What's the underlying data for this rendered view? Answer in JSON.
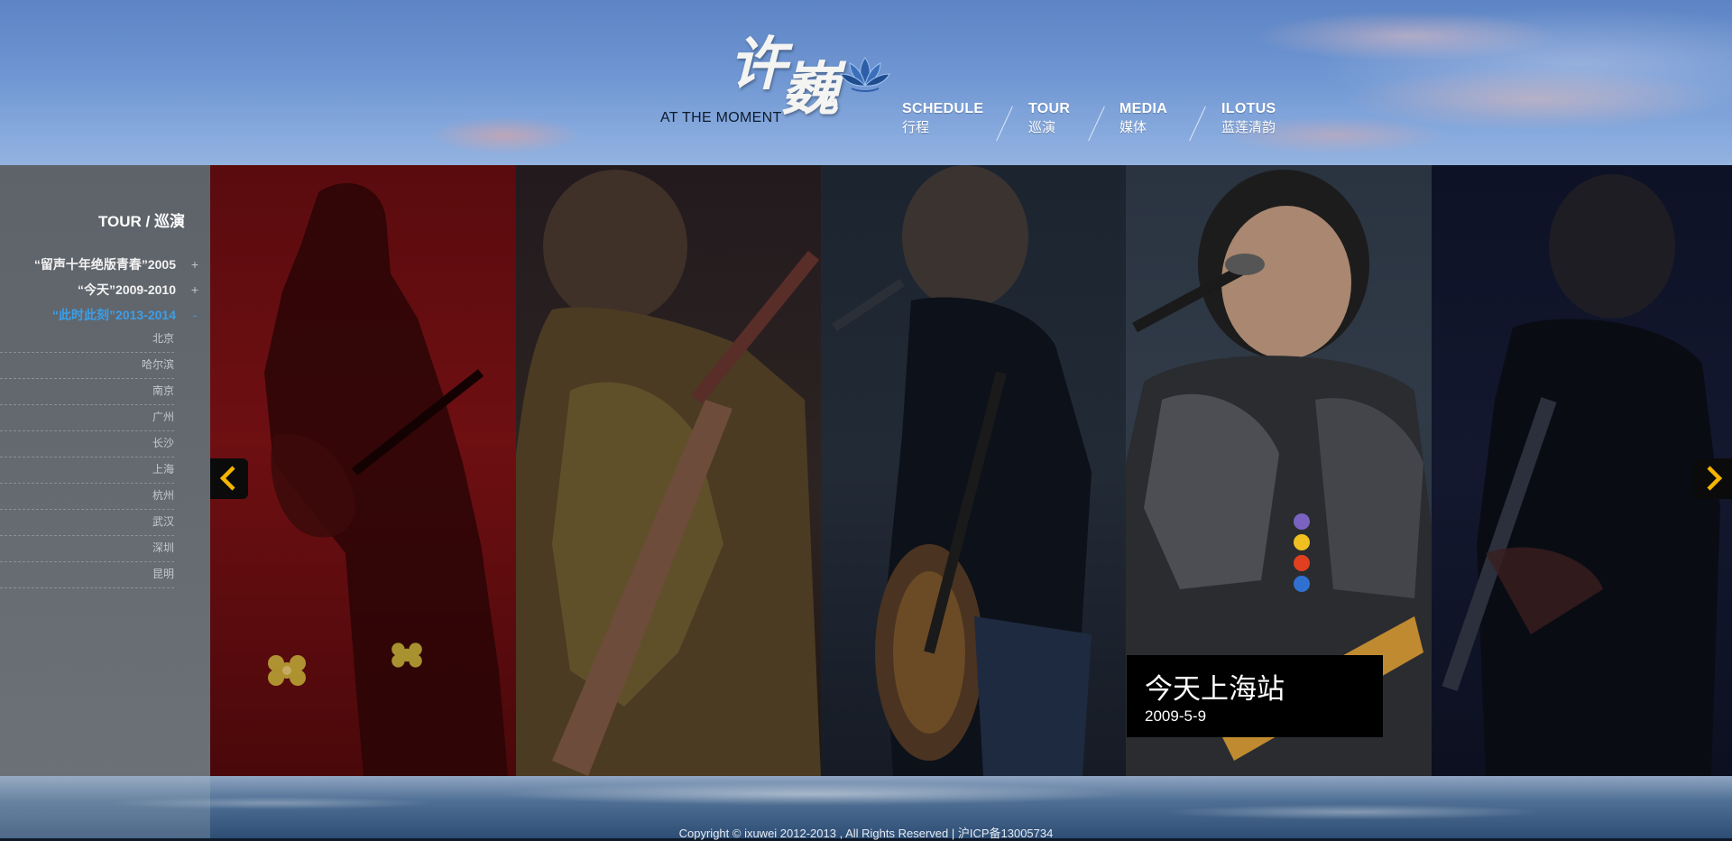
{
  "brand": {
    "logo_subtitle": "AT THE MOMENT",
    "logo_glyph_1": "许",
    "logo_glyph_2": "巍"
  },
  "nav": [
    {
      "en": "SCHEDULE",
      "cn": "行程"
    },
    {
      "en": "TOUR",
      "cn": "巡演"
    },
    {
      "en": "MEDIA",
      "cn": "媒体"
    },
    {
      "en": "ILOTUS",
      "cn": "蓝莲清韵"
    }
  ],
  "sidebar": {
    "title": "TOUR / 巡演",
    "series": [
      {
        "label": "“留声十年绝版青春”2005",
        "toggle": "+",
        "active": false
      },
      {
        "label": "“今天”2009-2010",
        "toggle": "+",
        "active": false
      },
      {
        "label": "“此时此刻”2013-2014",
        "toggle": "-",
        "active": true
      }
    ],
    "cities": [
      "北京",
      "哈尔滨",
      "南京",
      "广州",
      "长沙",
      "上海",
      "杭州",
      "武汉",
      "深圳",
      "昆明"
    ]
  },
  "gallery": {
    "caption_title": "今天上海站",
    "caption_date": "2009-5-9",
    "prev_icon": "chevron-left-icon",
    "next_icon": "chevron-right-icon",
    "accent": "#f5b400"
  },
  "footer": {
    "copyright": "Copyright © ixuwei 2012-2013 , All Rights Reserved | 沪ICP备13005734"
  },
  "colors": {
    "active_series": "#3b9ee8",
    "sidebar_bg": "#656a71",
    "caption_bg": "#000000"
  }
}
